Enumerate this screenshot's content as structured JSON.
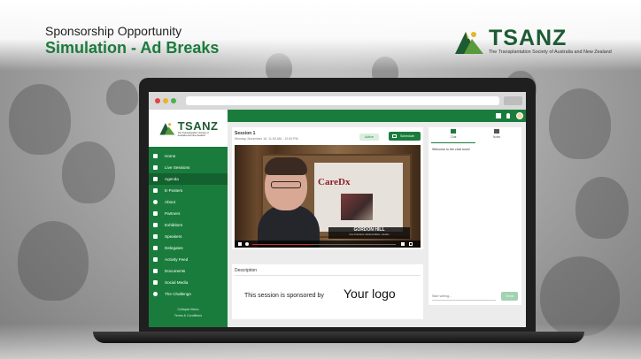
{
  "slide": {
    "subtitle": "Sponsorship Opportunity",
    "title": "Simulation - Ad Breaks"
  },
  "brand": {
    "name": "TSANZ",
    "tagline": "The Transplantation Society of Australia and New Zealand"
  },
  "app": {
    "sidebar": {
      "logo_name": "TSANZ",
      "logo_tagline": "The Transplantation Society of Australia and New Zealand",
      "items": [
        {
          "label": "Home",
          "icon": "home-icon"
        },
        {
          "label": "Live Sessions",
          "icon": "live-sessions-icon"
        },
        {
          "label": "Agenda",
          "icon": "calendar-icon"
        },
        {
          "label": "E-Posters",
          "icon": "poster-icon"
        },
        {
          "label": "About",
          "icon": "info-icon"
        },
        {
          "label": "Partners",
          "icon": "partners-icon"
        },
        {
          "label": "Exhibitors",
          "icon": "exhibitors-icon"
        },
        {
          "label": "Speakers",
          "icon": "speakers-icon"
        },
        {
          "label": "Delegates",
          "icon": "delegates-icon"
        },
        {
          "label": "Activity Feed",
          "icon": "share-icon"
        },
        {
          "label": "Documents",
          "icon": "document-icon"
        },
        {
          "label": "Social Media",
          "icon": "social-media-icon"
        },
        {
          "label": "The Challenge",
          "icon": "challenge-icon"
        }
      ],
      "active_item": "Agenda",
      "collapse_label": "Collapse Menu",
      "footer_link": "Terms & Conditions"
    },
    "session": {
      "title": "Session 1",
      "date": "Monday, November 16, 11:00 AM - 12:00 PM",
      "status_label": "Active",
      "schedule_label": "Schedule"
    },
    "video": {
      "backdrop_text": "CareDx",
      "speaker_name": "GORDON HILL",
      "speaker_role": "Vice President, Medical Affairs, CareDx",
      "progress": 0.42
    },
    "description": {
      "label": "Description",
      "sponsor_text": "This session is sponsored by",
      "logo_placeholder": "Your logo"
    },
    "chat": {
      "tabs": [
        {
          "label": "Chat",
          "icon": "chat-icon"
        },
        {
          "label": "Notes",
          "icon": "notes-icon"
        }
      ],
      "welcome": "Welcome to the chat room!",
      "input_placeholder": "Start writing...",
      "send_label": "Send"
    }
  },
  "colors": {
    "primary_green": "#1a7c3c",
    "title_green": "#1c7a3c",
    "brand_dark_green": "#1d5b34",
    "caredx_red": "#8b1f2e",
    "progress_red": "#d32f2f"
  }
}
